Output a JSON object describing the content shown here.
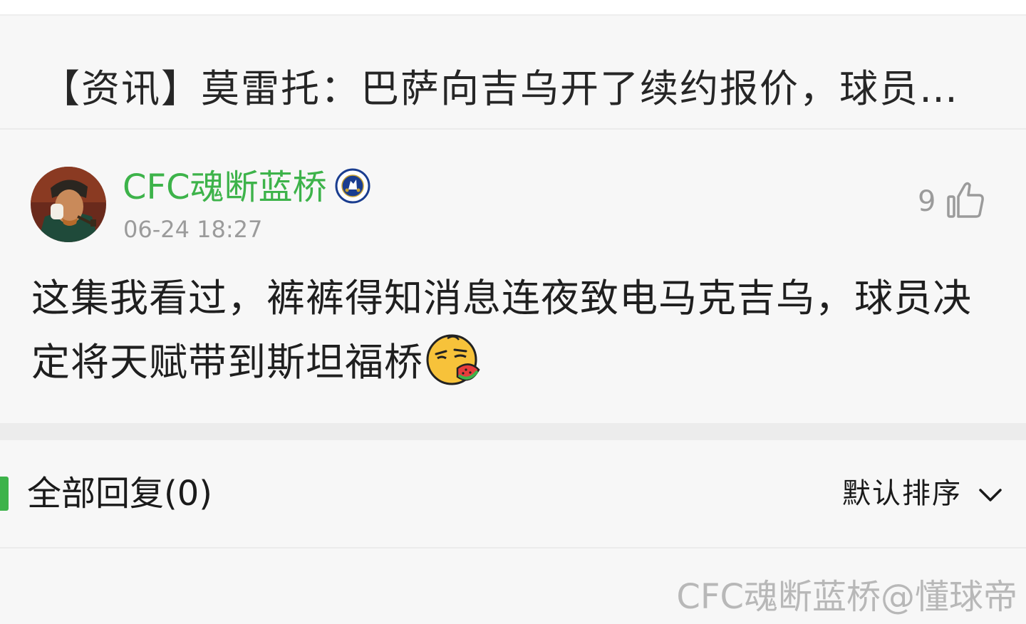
{
  "headline": {
    "text": "【资讯】莫雷托：巴萨向吉乌开了续约报价，球员方..."
  },
  "comment": {
    "username": "CFC魂断蓝桥",
    "badge_icon": "chelsea-crest-icon",
    "timestamp": "06-24 18:27",
    "like_count": "9",
    "like_icon": "thumbs-up-icon",
    "body_text": "这集我看过，裤裤得知消息连夜致电马克吉乌，球员决定将天赋带到斯坦福桥",
    "emoji_icon": "eating-watermelon-emoji-icon"
  },
  "replies": {
    "title": "全部回复(0)",
    "sort_label": "默认排序",
    "sort_icon": "chevron-down-icon"
  },
  "watermark": {
    "text": "CFC魂断蓝桥@懂球帝"
  },
  "colors": {
    "accent_green": "#3db34a",
    "muted_gray": "#9b9b9b",
    "background": "#f7f7f7",
    "section_gap": "#ececec"
  }
}
